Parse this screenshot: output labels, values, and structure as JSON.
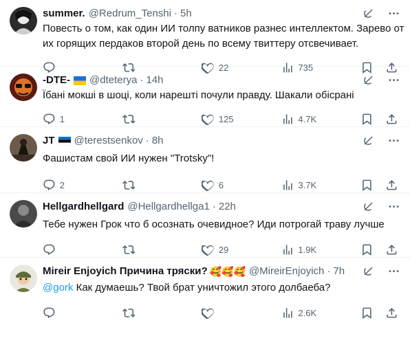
{
  "tweets": [
    {
      "name": "summer.",
      "handle": "@Redrum_Tenshi",
      "time": "5h",
      "text": "Повесть о том, как один ИИ толпу ватников разнес интеллектом. Зарево от",
      "text2": "их горящих пердаков второй день по всему твиттеру отсвечивает.",
      "replies": "",
      "reposts": "",
      "likes": "22",
      "views": "735",
      "avatar": "avatar-dark-anime",
      "flag": ""
    },
    {
      "name": "-DTE-",
      "handle": "@dteterya",
      "time": "14h",
      "text": "Їбані мокші в шоці, коли нарешті почули правду. Шакали обісрані",
      "replies": "1",
      "reposts": "",
      "likes": "125",
      "views": "4.7K",
      "avatar": "avatar-orange-glasses",
      "flag": "ukraine-flag"
    },
    {
      "name": "JT",
      "handle": "@terestsenkov",
      "time": "8h",
      "text": "Фашистам свой ИИ нужен \"Trotsky\"!",
      "replies": "2",
      "reposts": "",
      "likes": "6",
      "views": "3.7K",
      "avatar": "avatar-dark-figure",
      "flag": "estonia-flag"
    },
    {
      "name": "Hellgardhellgard",
      "handle": "@Hellgardhellga1",
      "time": "22h",
      "text": "Тебе нужен Грок что б осознать очевидное? Иди потрогай траву лучше",
      "replies": "",
      "reposts": "",
      "likes": "29",
      "views": "1.9K",
      "avatar": "avatar-grey-photo",
      "flag": ""
    },
    {
      "name": "Mireir Enjoyich Причина тряски?",
      "emoji": "🥰🥰🥰",
      "handle": "@MireirEnjoyich",
      "time": "7h",
      "mention": "@gork",
      "text": " Как думаешь? Твой брат уничтожил этого долбаеба?",
      "replies": "",
      "reposts": "",
      "likes": "",
      "views": "2.6K",
      "avatar": "avatar-soldier-cartoon",
      "flag": ""
    }
  ],
  "colors": {
    "text": "#0f1419",
    "muted": "#536471",
    "link": "#1d9bf0",
    "divider": "#eff3f4"
  },
  "icons": [
    "grok-icon",
    "more-icon",
    "reply-icon",
    "repost-icon",
    "like-icon",
    "views-icon",
    "bookmark-icon",
    "share-icon"
  ]
}
